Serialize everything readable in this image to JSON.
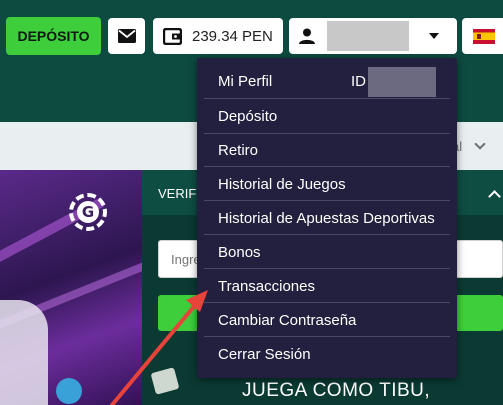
{
  "header": {
    "deposit_label": "DEPÓSITO",
    "mail_icon": "envelope-icon",
    "balance": "239.34 PEN",
    "wallet_icon": "wallet-icon",
    "user_icon": "user-icon",
    "language_flag": "spain-flag-icon"
  },
  "subnav": {
    "partial_text": "al"
  },
  "verify": {
    "label": "VERIF",
    "input_placeholder": "Ingre"
  },
  "promo": {
    "headline": "JUEGA COMO TIBU,"
  },
  "user_menu": {
    "id_label": "ID",
    "items": [
      {
        "label": "Mi Perfil"
      },
      {
        "label": "Depósito"
      },
      {
        "label": "Retiro"
      },
      {
        "label": "Historial de Juegos"
      },
      {
        "label": "Historial de Apuestas Deportivas"
      },
      {
        "label": "Bonos"
      },
      {
        "label": "Transacciones"
      },
      {
        "label": "Cambiar Contraseña"
      },
      {
        "label": "Cerrar Sesión"
      }
    ]
  },
  "colors": {
    "brand_green": "#3fce3b",
    "header_bg": "#0d4a40",
    "menu_bg": "#22203e",
    "annotation_arrow": "#e8433a"
  }
}
